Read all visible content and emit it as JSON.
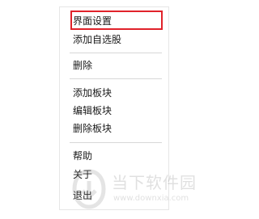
{
  "context_menu": {
    "items": [
      "界面设置",
      "添加自选股",
      "删除",
      "添加板块",
      "编辑板块",
      "删除板块",
      "帮助",
      "关于",
      "退出"
    ],
    "highlighted_item": "界面设置",
    "highlight_color": "#e0222a"
  },
  "watermark": {
    "text": "当下软件园",
    "url": "www.downxia.com",
    "icon": "download-logo-icon"
  }
}
